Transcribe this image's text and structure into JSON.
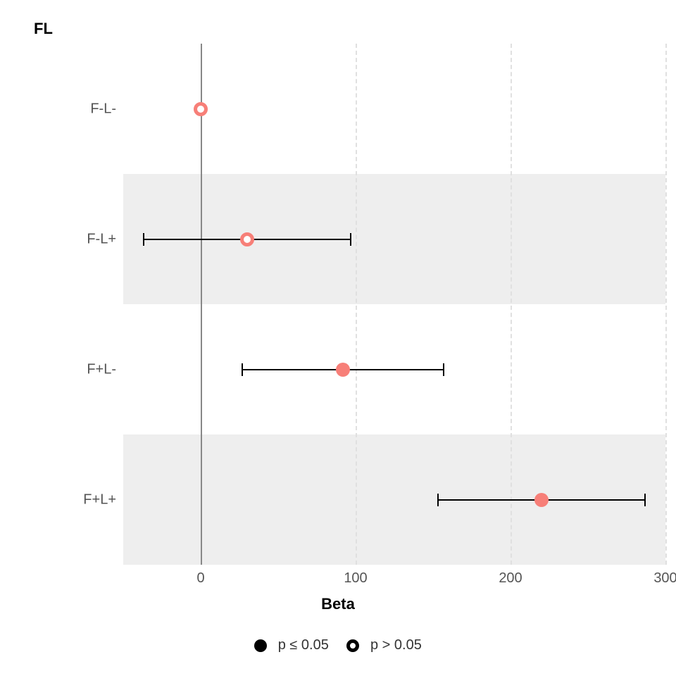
{
  "chart_data": {
    "type": "scatter",
    "title": "FL",
    "xlabel": "Beta",
    "ylabel": "",
    "xlim": [
      -50,
      300
    ],
    "x_ticks": [
      0,
      100,
      200,
      300
    ],
    "categories": [
      "F-L-",
      "F-L+",
      "F+L-",
      "F+L+"
    ],
    "series": [
      {
        "name": "F-L-",
        "beta": 0,
        "ci_low": 0,
        "ci_high": 0,
        "sig": false
      },
      {
        "name": "F-L+",
        "beta": 30,
        "ci_low": -37,
        "ci_high": 97,
        "sig": false
      },
      {
        "name": "F+L-",
        "beta": 92,
        "ci_low": 27,
        "ci_high": 157,
        "sig": true
      },
      {
        "name": "F+L+",
        "beta": 220,
        "ci_low": 153,
        "ci_high": 287,
        "sig": true
      }
    ],
    "legend": [
      {
        "label": "p ≤ 0.05",
        "style": "filled"
      },
      {
        "label": "p > 0.05",
        "style": "hollow"
      }
    ]
  }
}
